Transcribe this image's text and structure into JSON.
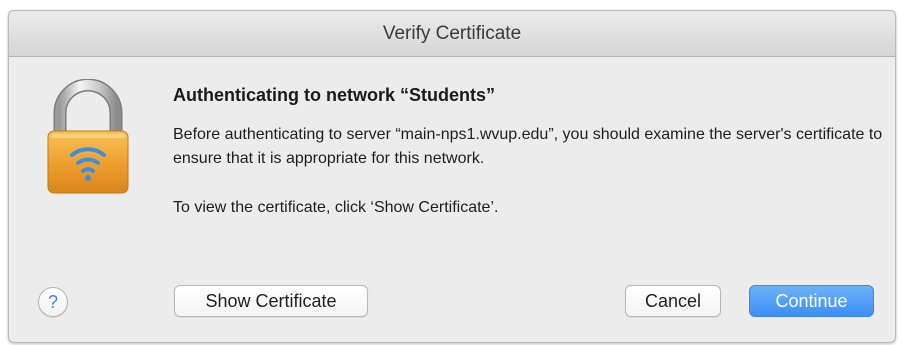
{
  "window": {
    "title": "Verify Certificate"
  },
  "dialog": {
    "lock_icon": "lock-wifi-icon",
    "heading": "Authenticating to network “Students”",
    "body": "Before authenticating to server “main-nps1.wvup.edu”, you should examine the server's certificate to ensure that it is appropriate for this network.",
    "hint": "To view the certificate, click ‘Show Certificate’.",
    "help_label": "?",
    "buttons": {
      "show_certificate": "Show Certificate",
      "cancel": "Cancel",
      "continue": "Continue"
    }
  },
  "colors": {
    "primary": "#3d8ff5",
    "lock_body": "#f0a030",
    "wifi": "#3c8fe0"
  }
}
